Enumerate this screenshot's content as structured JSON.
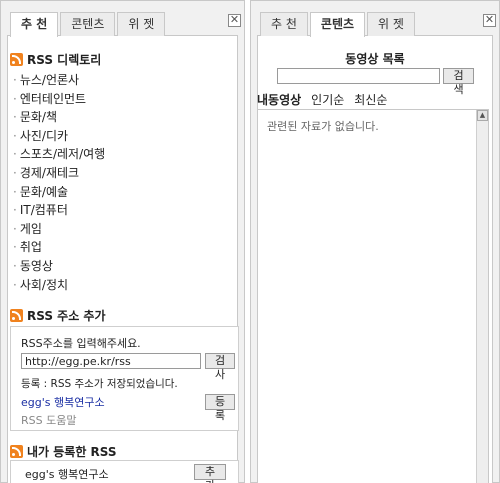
{
  "left": {
    "tabs": [
      "추 천",
      "콘텐츠",
      "위 젯"
    ],
    "active_tab": 0,
    "close": "✕",
    "directory": {
      "title": "RSS 디렉토리",
      "items": [
        "뉴스/언론사",
        "엔터테인먼트",
        "문화/책",
        "사진/디카",
        "스포츠/레저/여행",
        "경제/재테크",
        "문화/예술",
        "IT/컴퓨터",
        "게임",
        "취업",
        "동영상",
        "사회/정치"
      ]
    },
    "rss_add": {
      "title": "RSS 주소 추가",
      "prompt": "RSS주소를 입력해주세요.",
      "input_value": "http://egg.pe.kr/rss",
      "check_label": "검사",
      "status": "등록 : RSS 주소가 저장되었습니다.",
      "feed_name": "egg's 행복연구소",
      "register_label": "등록",
      "help": "RSS 도움말"
    },
    "my_rss": {
      "title": "내가 등록한 RSS",
      "items": [
        {
          "name": "egg's 행복연구소",
          "action": "추가"
        }
      ]
    }
  },
  "right": {
    "tabs": [
      "추 천",
      "콘텐츠",
      "위 젯"
    ],
    "active_tab": 1,
    "close": "✕",
    "video_list": {
      "title": "동영상 목록",
      "search_placeholder": "",
      "search_label": "검색",
      "filters": [
        "내동영상",
        "인기순",
        "최신순"
      ],
      "empty_message": "관련된 자료가 없습니다."
    }
  }
}
